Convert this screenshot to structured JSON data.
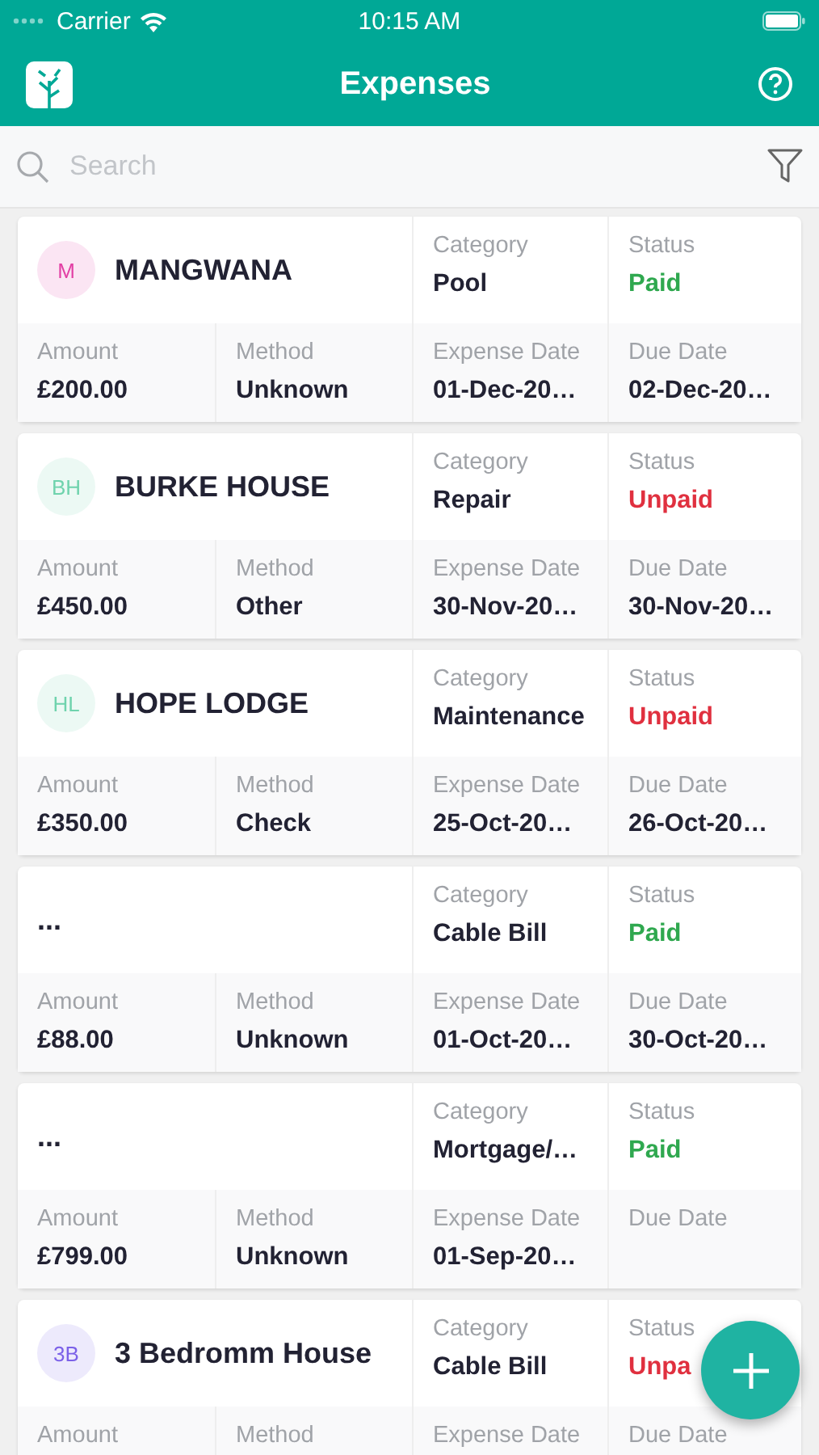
{
  "status_bar": {
    "carrier": "Carrier",
    "time": "10:15 AM"
  },
  "header": {
    "title": "Expenses"
  },
  "search": {
    "placeholder": "Search"
  },
  "expenses": [
    {
      "initials": "M",
      "color": "#e23fa4",
      "name": "MANGWANA",
      "category_label": "Category",
      "category": "Pool",
      "status_label": "Status",
      "status": "Paid",
      "paid": true,
      "fields": [
        {
          "label": "Amount",
          "value": "£200.00"
        },
        {
          "label": "Method",
          "value": "Unknown"
        },
        {
          "label": "Expense Date",
          "value": "01-Dec-20…"
        },
        {
          "label": "Due Date",
          "value": "02-Dec-20…"
        }
      ]
    },
    {
      "initials": "BH",
      "color": "#6fd3ad",
      "name": "BURKE HOUSE",
      "category_label": "Category",
      "category": "Repair",
      "status_label": "Status",
      "status": "Unpaid",
      "paid": false,
      "fields": [
        {
          "label": "Amount",
          "value": "£450.00"
        },
        {
          "label": "Method",
          "value": "Other"
        },
        {
          "label": "Expense Date",
          "value": "30-Nov-20…"
        },
        {
          "label": "Due Date",
          "value": "30-Nov-20…"
        }
      ]
    },
    {
      "initials": "HL",
      "color": "#6fd3ad",
      "name": "HOPE LODGE",
      "category_label": "Category",
      "category": "Maintenance",
      "status_label": "Status",
      "status": "Unpaid",
      "paid": false,
      "fields": [
        {
          "label": "Amount",
          "value": "£350.00"
        },
        {
          "label": "Method",
          "value": "Check"
        },
        {
          "label": "Expense Date",
          "value": "25-Oct-20…"
        },
        {
          "label": "Due Date",
          "value": "26-Oct-20…"
        }
      ]
    },
    {
      "name": "...",
      "category_label": "Category",
      "category": "Cable Bill",
      "status_label": "Status",
      "status": "Paid",
      "paid": true,
      "fields": [
        {
          "label": "Amount",
          "value": "£88.00"
        },
        {
          "label": "Method",
          "value": "Unknown"
        },
        {
          "label": "Expense Date",
          "value": "01-Oct-20…"
        },
        {
          "label": "Due Date",
          "value": "30-Oct-20…"
        }
      ]
    },
    {
      "name": "...",
      "category_label": "Category",
      "category": "Mortgage/…",
      "status_label": "Status",
      "status": "Paid",
      "paid": true,
      "fields": [
        {
          "label": "Amount",
          "value": "£799.00"
        },
        {
          "label": "Method",
          "value": "Unknown"
        },
        {
          "label": "Expense Date",
          "value": "01-Sep-20…"
        },
        {
          "label": "Due Date"
        }
      ]
    },
    {
      "initials": "3B",
      "color": "#7b61e8",
      "name": "3 Bedromm House",
      "category_label": "Category",
      "category": "Cable Bill",
      "status_label": "Status",
      "status": "Unpa",
      "paid": false,
      "fields": [
        {
          "label": "Amount"
        },
        {
          "label": "Method"
        },
        {
          "label": "Expense Date"
        },
        {
          "label": "Due Date"
        }
      ]
    }
  ]
}
